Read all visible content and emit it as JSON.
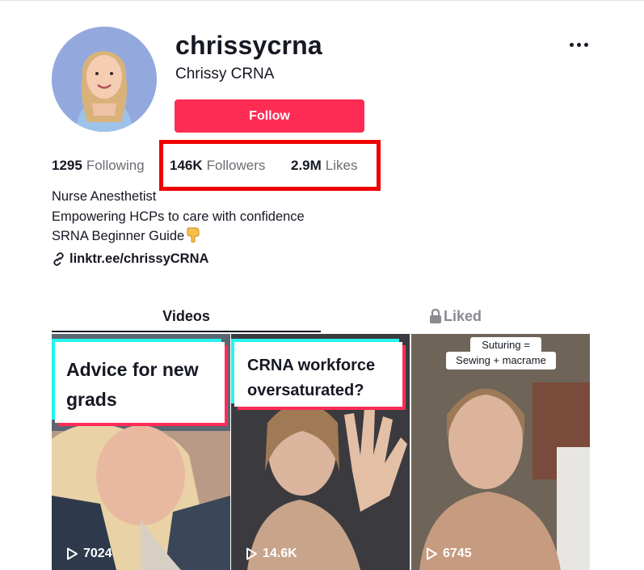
{
  "profile": {
    "username": "chrissycrna",
    "display_name": "Chrissy CRNA",
    "follow_label": "Follow"
  },
  "stats": {
    "following_count": "1295",
    "following_label": "Following",
    "followers_count": "146K",
    "followers_label": "Followers",
    "likes_count": "2.9M",
    "likes_label": "Likes"
  },
  "bio": {
    "line1": "Nurse Anesthetist",
    "line2": "Empowering HCPs to care with confidence",
    "line3": "SRNA Beginner Guide"
  },
  "link": {
    "text": "linktr.ee/chrissyCRNA"
  },
  "tabs": {
    "videos": "Videos",
    "liked": "Liked"
  },
  "videos": [
    {
      "caption": "Advice for new grads",
      "views": "7024"
    },
    {
      "caption": "CRNA workforce oversaturated?",
      "views": "14.6K"
    },
    {
      "caption_line1": "Suturing =",
      "caption_line2": "Sewing + macrame",
      "views": "6745"
    }
  ],
  "colors": {
    "accent": "#fe2c55",
    "highlight": "#ee0000",
    "caption_cyan": "#25f4ee"
  },
  "icons": [
    "more-icon",
    "link-icon",
    "lock-icon",
    "play-icon",
    "pointing-down-emoji"
  ]
}
